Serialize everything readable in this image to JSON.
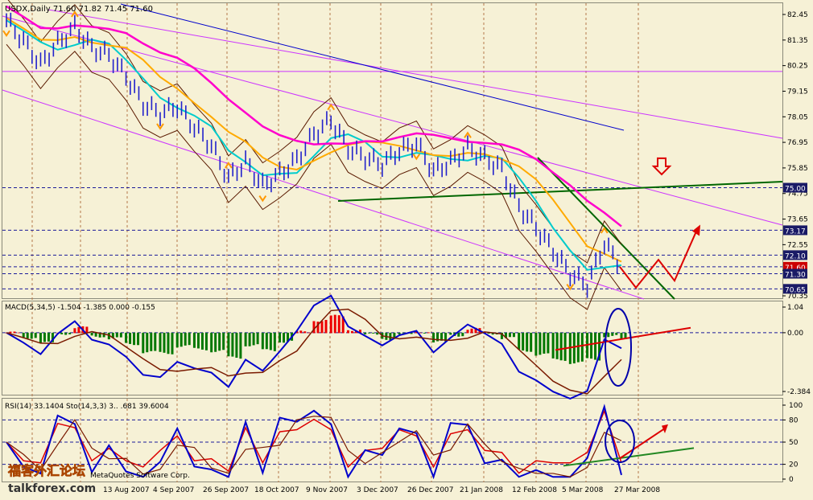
{
  "colors": {
    "background": "#f6f1d6",
    "price_up": "#2222cc",
    "price_down": "#2222cc",
    "ma_fast": "#00cccc",
    "ma_mid": "#ffaa00",
    "ma_slow": "#ff00cc",
    "ma_long": "#0000cc",
    "bands": "#5a1a00",
    "channel": "#cc33ff",
    "trend_green": "#006600",
    "signal_red": "#dd0000",
    "macd_up": "#ee0000",
    "macd_down": "#007700",
    "highlight": "#0000aa"
  },
  "watermark": {
    "cn": "福客外汇论坛",
    "en": "talkforex.com",
    "copyright": "MetaQuotes Software Corp."
  },
  "chart_data": [
    {
      "type": "line",
      "panel": "price",
      "header": "USDX,Daily  71.60 71.82 71.45 71.60",
      "symbol": "USDX",
      "timeframe": "Daily",
      "ohlc_last": {
        "open": 71.6,
        "high": 71.82,
        "low": 71.45,
        "close": 71.6
      },
      "ylim": [
        70.35,
        82.45
      ],
      "y_ticks": [
        82.45,
        81.35,
        80.25,
        79.15,
        78.05,
        76.95,
        75.85,
        74.75,
        73.65,
        72.55,
        71.45,
        70.35
      ],
      "x_ticks": [
        "13 Aug 2007",
        "4 Sep 2007",
        "26 Sep 2007",
        "18 Oct 2007",
        "9 Nov 2007",
        "3 Dec 2007",
        "26 Dec 2007",
        "21 Jan 2008",
        "12 Feb 2008",
        "5 Mar 2008",
        "27 Mar 2008"
      ],
      "price_labels": [
        {
          "value": 75.0,
          "text": "75.00",
          "style": "dark"
        },
        {
          "value": 73.17,
          "text": "73.17",
          "style": "dark"
        },
        {
          "value": 72.1,
          "text": "72.10",
          "style": "dark"
        },
        {
          "value": 71.6,
          "text": "71.60",
          "style": "red"
        },
        {
          "value": 71.3,
          "text": "71.30",
          "style": "dark"
        },
        {
          "value": 70.65,
          "text": "70.65",
          "style": "dark"
        }
      ],
      "horizontal_lines": [
        80.0,
        75.0,
        73.17,
        72.1,
        71.6,
        71.3,
        70.65
      ],
      "close_series": [
        {
          "x": "Jul 2007",
          "y": 82.2
        },
        {
          "x": "Jul 2007",
          "y": 81.3
        },
        {
          "x": "Aug 2007",
          "y": 80.3
        },
        {
          "x": "Aug 2007",
          "y": 81.2
        },
        {
          "x": "13 Aug 2007",
          "y": 81.9
        },
        {
          "x": "Aug 2007",
          "y": 81.0
        },
        {
          "x": "4 Sep 2007",
          "y": 80.7
        },
        {
          "x": "Sep 2007",
          "y": 79.8
        },
        {
          "x": "Sep 2007",
          "y": 78.6
        },
        {
          "x": "26 Sep 2007",
          "y": 78.2
        },
        {
          "x": "Oct 2007",
          "y": 78.5
        },
        {
          "x": "18 Oct 2007",
          "y": 77.6
        },
        {
          "x": "Oct 2007",
          "y": 76.8
        },
        {
          "x": "Oct 2007",
          "y": 75.4
        },
        {
          "x": "Nov 2007",
          "y": 76.1
        },
        {
          "x": "9 Nov 2007",
          "y": 75.1
        },
        {
          "x": "Nov 2007",
          "y": 75.6
        },
        {
          "x": "Nov 2007",
          "y": 76.2
        },
        {
          "x": "3 Dec 2007",
          "y": 77.3
        },
        {
          "x": "Dec 2007",
          "y": 77.9
        },
        {
          "x": "Dec 2007",
          "y": 76.7
        },
        {
          "x": "26 Dec 2007",
          "y": 76.3
        },
        {
          "x": "Jan 2008",
          "y": 76.0
        },
        {
          "x": "Jan 2008",
          "y": 76.6
        },
        {
          "x": "Jan 2008",
          "y": 76.9
        },
        {
          "x": "21 Jan 2008",
          "y": 75.7
        },
        {
          "x": "Feb 2008",
          "y": 76.1
        },
        {
          "x": "Feb 2008",
          "y": 76.7
        },
        {
          "x": "12 Feb 2008",
          "y": 76.3
        },
        {
          "x": "Feb 2008",
          "y": 75.8
        },
        {
          "x": "Feb 2008",
          "y": 74.2
        },
        {
          "x": "Feb 2008",
          "y": 73.3
        },
        {
          "x": "Mar 2008",
          "y": 72.3
        },
        {
          "x": "5 Mar 2008",
          "y": 71.3
        },
        {
          "x": "Mar 2008",
          "y": 70.8
        },
        {
          "x": "Mar 2008",
          "y": 72.6
        },
        {
          "x": "Mar 2008",
          "y": 71.6
        }
      ],
      "projection_arrow": [
        {
          "x": "Mar 2008",
          "y": 71.6
        },
        {
          "x": "Mar 2008",
          "y": 70.7
        },
        {
          "x": "Apr 2008",
          "y": 71.9
        },
        {
          "x": "Apr 2008",
          "y": 71.0
        },
        {
          "x": "Apr 2008",
          "y": 73.2
        }
      ],
      "annotation_down_arrow": {
        "x": "Apr 2008",
        "y": 75.85
      }
    },
    {
      "type": "line",
      "panel": "macd",
      "header": "MACD(5,34,5) -1.504 -1.385 0.000 -0.155",
      "name": "MACD(5,34,5)",
      "values_shown": [
        -1.504,
        -1.385,
        0.0,
        -0.155
      ],
      "ylim": [
        -2.384,
        1.04
      ],
      "y_ticks": [
        1.04,
        0.0,
        -2.384
      ]
    },
    {
      "type": "line",
      "panel": "rsi_stoch",
      "header": "RSI(14) 33.1404  Sto(14,3,3) 3.. .681 39.6004",
      "name": "RSI(14), Sto(14,3,3)",
      "rsi_last": 33.1404,
      "stoch_last": 39.6004,
      "ylim": [
        0,
        100
      ],
      "y_ticks": [
        100,
        80,
        50,
        20,
        0
      ]
    }
  ]
}
